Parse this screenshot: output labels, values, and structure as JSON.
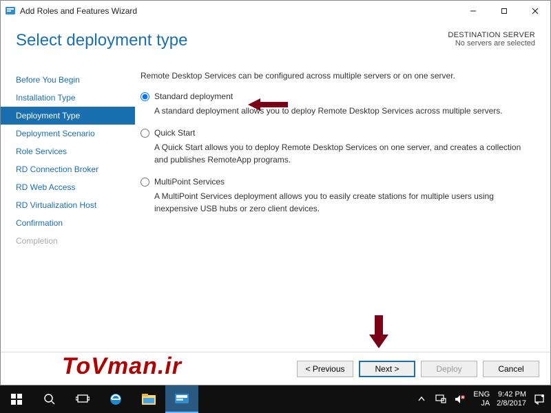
{
  "window": {
    "title": "Add Roles and Features Wizard"
  },
  "header": {
    "page_title": "Select deployment type",
    "destination_label": "DESTINATION SERVER",
    "destination_value": "No servers are selected"
  },
  "sidebar": {
    "items": [
      {
        "label": "Before You Begin",
        "state": "normal"
      },
      {
        "label": "Installation Type",
        "state": "normal"
      },
      {
        "label": "Deployment Type",
        "state": "active"
      },
      {
        "label": "Deployment Scenario",
        "state": "normal"
      },
      {
        "label": "Role Services",
        "state": "normal"
      },
      {
        "label": "RD Connection Broker",
        "state": "normal"
      },
      {
        "label": "RD Web Access",
        "state": "normal"
      },
      {
        "label": "RD Virtualization Host",
        "state": "normal"
      },
      {
        "label": "Confirmation",
        "state": "normal"
      },
      {
        "label": "Completion",
        "state": "disabled"
      }
    ]
  },
  "main": {
    "intro": "Remote Desktop Services can be configured across multiple servers or on one server.",
    "options": [
      {
        "label": "Standard deployment",
        "desc": "A standard deployment allows you to deploy Remote Desktop Services across multiple servers.",
        "selected": true
      },
      {
        "label": "Quick Start",
        "desc": "A Quick Start allows you to deploy Remote Desktop Services on one server, and creates a collection and publishes RemoteApp programs.",
        "selected": false
      },
      {
        "label": "MultiPoint Services",
        "desc": "A MultiPoint Services deployment allows you to easily create stations for multiple users using inexpensive USB hubs or zero client devices.",
        "selected": false
      }
    ]
  },
  "buttons": {
    "previous": "< Previous",
    "next": "Next >",
    "deploy": "Deploy",
    "cancel": "Cancel"
  },
  "watermark": "ToVman.ir",
  "taskbar": {
    "lang1": "ENG",
    "lang2": "JA",
    "time": "9:42 PM",
    "date": "2/8/2017"
  }
}
